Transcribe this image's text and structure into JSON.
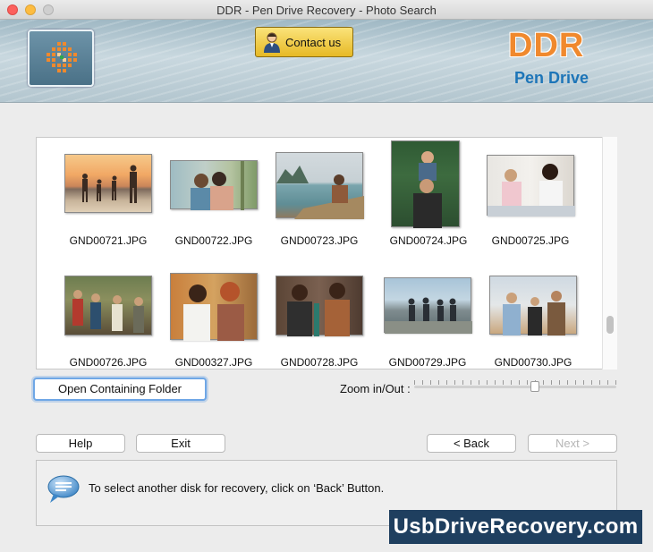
{
  "window": {
    "title": "DDR - Pen Drive Recovery - Photo Search"
  },
  "header": {
    "contact_label": "Contact us",
    "brand_name": "DDR",
    "brand_sub": "Pen Drive"
  },
  "photos": [
    {
      "filename": "GND00721.JPG"
    },
    {
      "filename": "GND00722.JPG"
    },
    {
      "filename": "GND00723.JPG"
    },
    {
      "filename": "GND00724.JPG"
    },
    {
      "filename": "GND00725.JPG"
    },
    {
      "filename": "GND00726.JPG"
    },
    {
      "filename": "GND00327.JPG"
    },
    {
      "filename": "GND00728.JPG"
    },
    {
      "filename": "GND00729.JPG"
    },
    {
      "filename": "GND00730.JPG"
    }
  ],
  "actions": {
    "open_folder_label": "Open Containing Folder",
    "zoom_label": "Zoom in/Out :",
    "zoom_level": 0.6
  },
  "footer": {
    "help_label": "Help",
    "exit_label": "Exit",
    "back_label": "< Back",
    "next_label": "Next >"
  },
  "status": {
    "message": "To select another disk for recovery, click on ‘Back’ Button."
  },
  "watermark": "UsbDriveRecovery.com",
  "colors": {
    "accent_orange": "#f0892d",
    "accent_blue": "#1d75b8",
    "contact_gold": "#e6b925",
    "watermark_bg": "#1f3f5f"
  }
}
